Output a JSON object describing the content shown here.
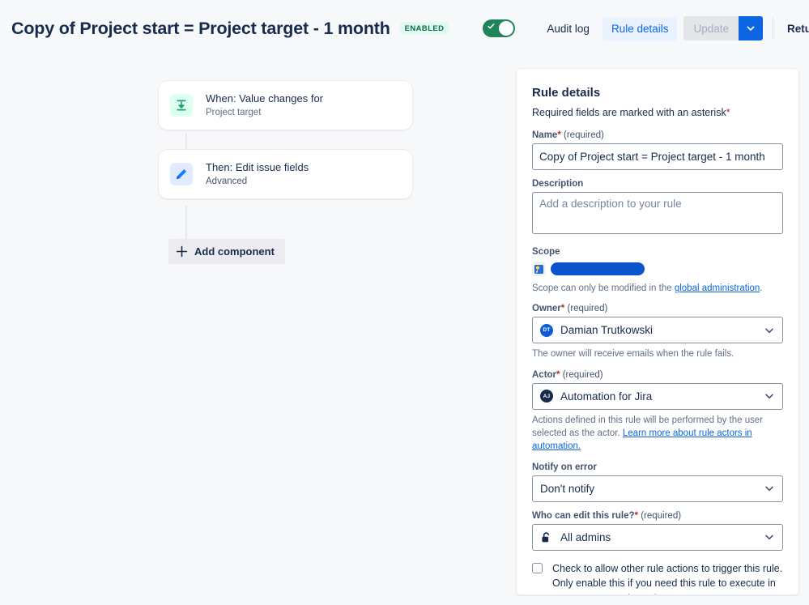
{
  "header": {
    "rule_title": "Copy of Project start = Project target - 1 month",
    "status_badge": "ENABLED",
    "toggle_state": "on",
    "audit_log_label": "Audit log",
    "rule_details_label": "Rule details",
    "update_label": "Update",
    "update_caret_icon": "chevron-down-icon",
    "return_label": "Return to rules",
    "accent_color": "#0c66e4",
    "enabled_badge_bg": "#e1fbf0",
    "enabled_badge_fg": "#0b6e47",
    "toggle_on_color": "#1f845a"
  },
  "flow": {
    "nodes": [
      {
        "title": "When: Value changes for",
        "subtitle": "Project target",
        "icon": "value-changes-icon",
        "icon_bg": "#dcfff1",
        "icon_fg": "#22a06b"
      },
      {
        "title": "Then: Edit issue fields",
        "subtitle": "Advanced",
        "icon": "pencil-icon",
        "icon_bg": "#e0ebff",
        "icon_fg": "#1d7afc"
      }
    ],
    "add_component_label": "Add component",
    "add_component_icon": "plus-icon"
  },
  "panel": {
    "title": "Rule details",
    "required_note_prefix": "Required fields are marked with an asterisk",
    "required_note_asterisk": "*",
    "name": {
      "label": "Name",
      "required_text": "(required)",
      "value": "Copy of Project start = Project target - 1 month"
    },
    "description": {
      "label": "Description",
      "value": "",
      "placeholder": "Add a description to your rule"
    },
    "scope": {
      "label": "Scope",
      "icon": "project-avatar-icon",
      "value_redacted": true,
      "helper_prefix": "Scope can only be modified in the",
      "helper_link": "global administration",
      "helper_suffix": "."
    },
    "owner": {
      "label": "Owner",
      "required_text": "(required)",
      "value": "Damian Trutkowski",
      "avatar_initials": "DT",
      "avatar_color": "#0b5ed7",
      "helper": "The owner will receive emails when the rule fails.",
      "caret_icon": "chevron-down-icon"
    },
    "actor": {
      "label": "Actor",
      "required_text": "(required)",
      "value": "Automation for Jira",
      "avatar_initials": "AJ",
      "avatar_color": "#172b4d",
      "helper_text": "Actions defined in this rule will be performed by the user selected as the actor.",
      "helper_link": "Learn more about rule actors in automation.",
      "caret_icon": "chevron-down-icon"
    },
    "notify": {
      "label": "Notify on error",
      "value": "Don't notify",
      "caret_icon": "chevron-down-icon"
    },
    "editors": {
      "label": "Who can edit this rule?",
      "required_text": "(required)",
      "value": "All admins",
      "icon": "unlock-icon",
      "caret_icon": "chevron-down-icon"
    },
    "allow_trigger": {
      "checked": false,
      "text": "Check to allow other rule actions to trigger this rule. Only enable this if you need this rule to execute in response to another rule."
    }
  }
}
